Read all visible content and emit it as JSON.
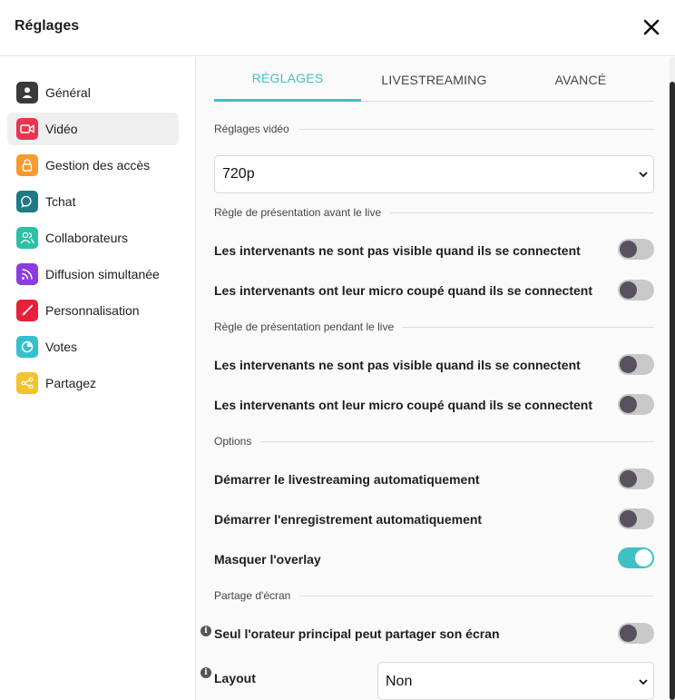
{
  "header": {
    "title": "Réglages"
  },
  "sidebar": {
    "items": [
      {
        "label": "Général",
        "color": "#3a3a3a"
      },
      {
        "label": "Vidéo",
        "color": "#e8344e"
      },
      {
        "label": "Gestion des accès",
        "color": "#f59b30"
      },
      {
        "label": "Tchat",
        "color": "#1f7a86"
      },
      {
        "label": "Collaborateurs",
        "color": "#2ec0a6"
      },
      {
        "label": "Diffusion simultanée",
        "color": "#8a3de0"
      },
      {
        "label": "Personnalisation",
        "color": "#e8203a"
      },
      {
        "label": "Votes",
        "color": "#36c0cf"
      },
      {
        "label": "Partagez",
        "color": "#f4c22b"
      }
    ],
    "active_index": 1
  },
  "tabs": [
    {
      "label": "RÉGLAGES",
      "active": true
    },
    {
      "label": "LIVESTREAMING",
      "active": false
    },
    {
      "label": "AVANCÉ",
      "active": false
    }
  ],
  "sections": {
    "video": "Réglages vidéo",
    "before_live": "Règle de présentation avant le live",
    "during_live": "Règle de présentation pendant le live",
    "options": "Options",
    "screen_share": "Partage d'écran"
  },
  "video_quality": {
    "value": "720p"
  },
  "before_live": [
    {
      "label": "Les intervenants ne sont pas visible quand ils se connectent",
      "on": false
    },
    {
      "label": "Les intervenants ont leur micro coupé quand ils se connectent",
      "on": false
    }
  ],
  "during_live": [
    {
      "label": "Les intervenants ne sont pas visible quand ils se connectent",
      "on": false
    },
    {
      "label": "Les intervenants ont leur micro coupé quand ils se connectent",
      "on": false
    }
  ],
  "options": [
    {
      "label": "Démarrer le livestreaming automatiquement",
      "on": false
    },
    {
      "label": "Démarrer l'enregistrement automatiquement",
      "on": false
    },
    {
      "label": "Masquer l'overlay",
      "on": true
    }
  ],
  "screen_share": {
    "main_speaker": {
      "label": "Seul l'orateur principal peut partager son écran",
      "on": false
    },
    "layout": {
      "label": "Layout",
      "value": "Non"
    }
  },
  "colors": {
    "accent": "#3ec1c4",
    "toggle_off": "#c8c8c8",
    "knob_off": "#5a5160"
  }
}
